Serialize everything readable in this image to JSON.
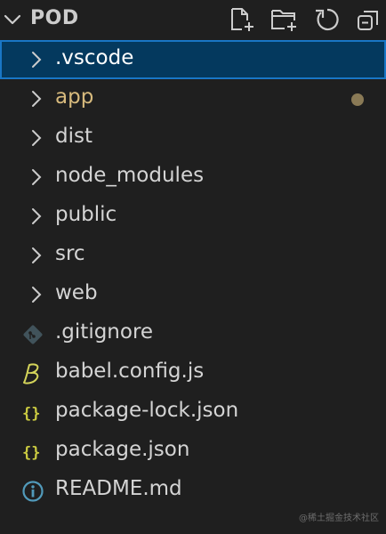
{
  "header": {
    "title": "POD",
    "actions": [
      {
        "name": "new-file-icon"
      },
      {
        "name": "new-folder-icon"
      },
      {
        "name": "refresh-icon"
      },
      {
        "name": "collapse-all-icon"
      }
    ]
  },
  "tree": {
    "selected": ".vscode",
    "folders": [
      {
        "label": ".vscode",
        "selected": true
      },
      {
        "label": "app",
        "modified": true
      },
      {
        "label": "dist"
      },
      {
        "label": "node_modules"
      },
      {
        "label": "public"
      },
      {
        "label": "src"
      },
      {
        "label": "web"
      }
    ],
    "files": [
      {
        "label": ".gitignore",
        "icon": "git-icon"
      },
      {
        "label": "babel.config.js",
        "icon": "babel-icon"
      },
      {
        "label": "package-lock.json",
        "icon": "json-braces-icon"
      },
      {
        "label": "package.json",
        "icon": "json-braces-icon"
      },
      {
        "label": "README.md",
        "icon": "info-icon"
      }
    ]
  },
  "colors": {
    "background": "#1f1f1f",
    "selection_bg": "#04395e",
    "selection_border": "#1976c5",
    "modified_text": "#d7ba7d",
    "modified_dot": "#8a7a56",
    "json_icon": "#cbcb41",
    "babel_icon": "#d4d45a",
    "info_icon": "#519aba",
    "git_icon": "#41535b"
  },
  "watermark": "@稀土掘金技术社区"
}
